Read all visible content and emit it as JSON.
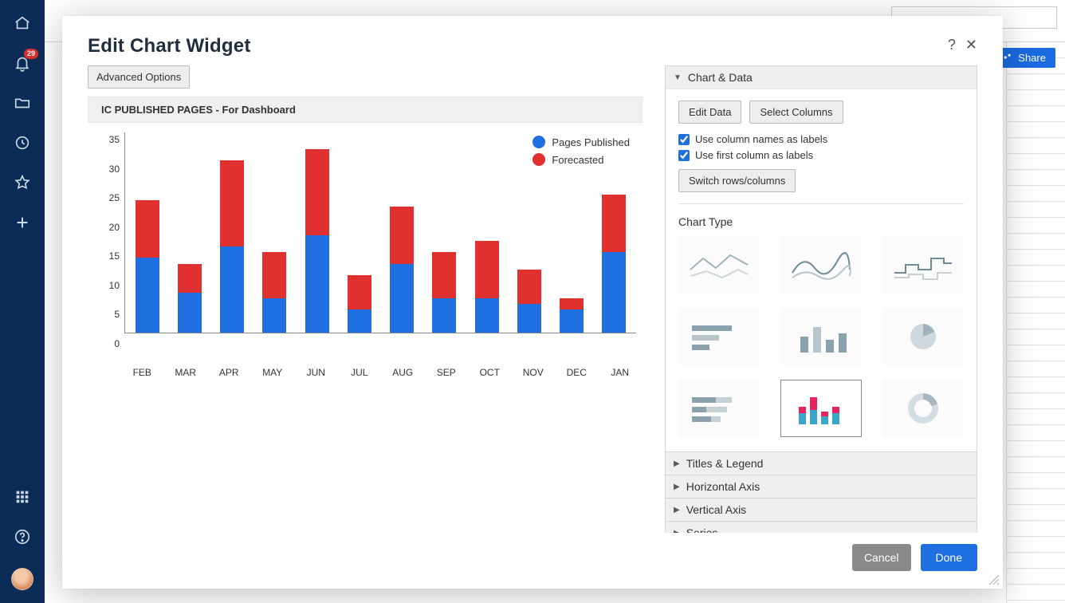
{
  "sidebar": {
    "notification_badge": "29"
  },
  "share_button": "Share",
  "modal": {
    "title": "Edit Chart Widget",
    "advanced_button": "Advanced Options",
    "help_icon_label": "?",
    "close_icon_label": "✕"
  },
  "chart_title": "IC PUBLISHED PAGES - For Dashboard",
  "legend": {
    "primary": "Pages Published",
    "secondary": "Forecasted"
  },
  "chart_data": {
    "type": "bar",
    "stacked": true,
    "categories": [
      "FEB",
      "MAR",
      "APR",
      "MAY",
      "JUN",
      "JUL",
      "AUG",
      "SEP",
      "OCT",
      "NOV",
      "DEC",
      "JAN"
    ],
    "series": [
      {
        "name": "Pages Published",
        "color": "#1f6fe0",
        "values": [
          13,
          7,
          15,
          6,
          17,
          4,
          12,
          6,
          6,
          5,
          4,
          14
        ]
      },
      {
        "name": "Forecasted",
        "color": "#e13030",
        "values": [
          10,
          5,
          15,
          8,
          15,
          6,
          10,
          8,
          10,
          6,
          2,
          10
        ]
      }
    ],
    "y_ticks": [
      0,
      5,
      10,
      15,
      20,
      25,
      30,
      35
    ],
    "ylim": [
      0,
      35
    ],
    "xlabel": "",
    "ylabel": "",
    "title": "IC PUBLISHED PAGES - For Dashboard",
    "legend_position": "right"
  },
  "config": {
    "sections": {
      "chart_data": "Chart & Data",
      "titles_legend": "Titles & Legend",
      "horizontal_axis": "Horizontal Axis",
      "vertical_axis": "Vertical Axis",
      "series": "Series"
    },
    "buttons": {
      "edit_data": "Edit Data",
      "select_columns": "Select Columns",
      "switch_rows_cols": "Switch rows/columns"
    },
    "checkboxes": {
      "use_column_names": "Use column names as labels",
      "use_first_column": "Use first column as labels"
    },
    "chart_type_label": "Chart Type",
    "chart_types": [
      "line",
      "line-smooth",
      "step",
      "bar-horizontal",
      "bar-vertical",
      "pie",
      "bar-horizontal-stacked",
      "bar-vertical-stacked",
      "donut"
    ],
    "selected_chart_type": "bar-vertical-stacked"
  },
  "footer": {
    "cancel": "Cancel",
    "done": "Done"
  },
  "colors": {
    "primary": "#1f6fe0",
    "danger": "#e13030",
    "sidebar": "#0a2c56"
  }
}
